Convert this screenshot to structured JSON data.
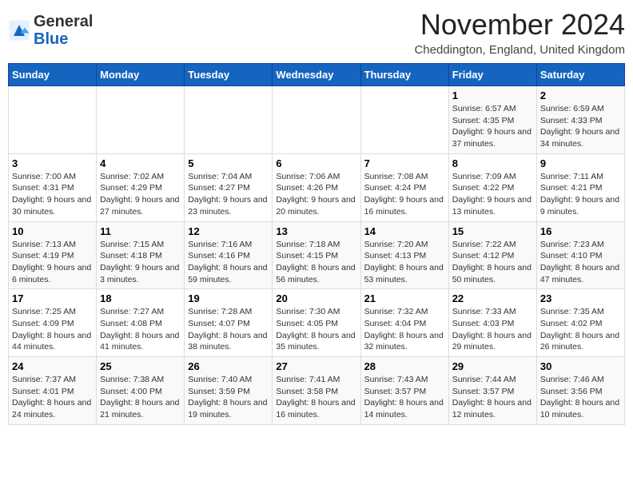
{
  "header": {
    "logo_general": "General",
    "logo_blue": "Blue",
    "month_title": "November 2024",
    "location": "Cheddington, England, United Kingdom"
  },
  "weekdays": [
    "Sunday",
    "Monday",
    "Tuesday",
    "Wednesday",
    "Thursday",
    "Friday",
    "Saturday"
  ],
  "weeks": [
    [
      {
        "day": "",
        "info": ""
      },
      {
        "day": "",
        "info": ""
      },
      {
        "day": "",
        "info": ""
      },
      {
        "day": "",
        "info": ""
      },
      {
        "day": "",
        "info": ""
      },
      {
        "day": "1",
        "info": "Sunrise: 6:57 AM\nSunset: 4:35 PM\nDaylight: 9 hours and 37 minutes."
      },
      {
        "day": "2",
        "info": "Sunrise: 6:59 AM\nSunset: 4:33 PM\nDaylight: 9 hours and 34 minutes."
      }
    ],
    [
      {
        "day": "3",
        "info": "Sunrise: 7:00 AM\nSunset: 4:31 PM\nDaylight: 9 hours and 30 minutes."
      },
      {
        "day": "4",
        "info": "Sunrise: 7:02 AM\nSunset: 4:29 PM\nDaylight: 9 hours and 27 minutes."
      },
      {
        "day": "5",
        "info": "Sunrise: 7:04 AM\nSunset: 4:27 PM\nDaylight: 9 hours and 23 minutes."
      },
      {
        "day": "6",
        "info": "Sunrise: 7:06 AM\nSunset: 4:26 PM\nDaylight: 9 hours and 20 minutes."
      },
      {
        "day": "7",
        "info": "Sunrise: 7:08 AM\nSunset: 4:24 PM\nDaylight: 9 hours and 16 minutes."
      },
      {
        "day": "8",
        "info": "Sunrise: 7:09 AM\nSunset: 4:22 PM\nDaylight: 9 hours and 13 minutes."
      },
      {
        "day": "9",
        "info": "Sunrise: 7:11 AM\nSunset: 4:21 PM\nDaylight: 9 hours and 9 minutes."
      }
    ],
    [
      {
        "day": "10",
        "info": "Sunrise: 7:13 AM\nSunset: 4:19 PM\nDaylight: 9 hours and 6 minutes."
      },
      {
        "day": "11",
        "info": "Sunrise: 7:15 AM\nSunset: 4:18 PM\nDaylight: 9 hours and 3 minutes."
      },
      {
        "day": "12",
        "info": "Sunrise: 7:16 AM\nSunset: 4:16 PM\nDaylight: 8 hours and 59 minutes."
      },
      {
        "day": "13",
        "info": "Sunrise: 7:18 AM\nSunset: 4:15 PM\nDaylight: 8 hours and 56 minutes."
      },
      {
        "day": "14",
        "info": "Sunrise: 7:20 AM\nSunset: 4:13 PM\nDaylight: 8 hours and 53 minutes."
      },
      {
        "day": "15",
        "info": "Sunrise: 7:22 AM\nSunset: 4:12 PM\nDaylight: 8 hours and 50 minutes."
      },
      {
        "day": "16",
        "info": "Sunrise: 7:23 AM\nSunset: 4:10 PM\nDaylight: 8 hours and 47 minutes."
      }
    ],
    [
      {
        "day": "17",
        "info": "Sunrise: 7:25 AM\nSunset: 4:09 PM\nDaylight: 8 hours and 44 minutes."
      },
      {
        "day": "18",
        "info": "Sunrise: 7:27 AM\nSunset: 4:08 PM\nDaylight: 8 hours and 41 minutes."
      },
      {
        "day": "19",
        "info": "Sunrise: 7:28 AM\nSunset: 4:07 PM\nDaylight: 8 hours and 38 minutes."
      },
      {
        "day": "20",
        "info": "Sunrise: 7:30 AM\nSunset: 4:05 PM\nDaylight: 8 hours and 35 minutes."
      },
      {
        "day": "21",
        "info": "Sunrise: 7:32 AM\nSunset: 4:04 PM\nDaylight: 8 hours and 32 minutes."
      },
      {
        "day": "22",
        "info": "Sunrise: 7:33 AM\nSunset: 4:03 PM\nDaylight: 8 hours and 29 minutes."
      },
      {
        "day": "23",
        "info": "Sunrise: 7:35 AM\nSunset: 4:02 PM\nDaylight: 8 hours and 26 minutes."
      }
    ],
    [
      {
        "day": "24",
        "info": "Sunrise: 7:37 AM\nSunset: 4:01 PM\nDaylight: 8 hours and 24 minutes."
      },
      {
        "day": "25",
        "info": "Sunrise: 7:38 AM\nSunset: 4:00 PM\nDaylight: 8 hours and 21 minutes."
      },
      {
        "day": "26",
        "info": "Sunrise: 7:40 AM\nSunset: 3:59 PM\nDaylight: 8 hours and 19 minutes."
      },
      {
        "day": "27",
        "info": "Sunrise: 7:41 AM\nSunset: 3:58 PM\nDaylight: 8 hours and 16 minutes."
      },
      {
        "day": "28",
        "info": "Sunrise: 7:43 AM\nSunset: 3:57 PM\nDaylight: 8 hours and 14 minutes."
      },
      {
        "day": "29",
        "info": "Sunrise: 7:44 AM\nSunset: 3:57 PM\nDaylight: 8 hours and 12 minutes."
      },
      {
        "day": "30",
        "info": "Sunrise: 7:46 AM\nSunset: 3:56 PM\nDaylight: 8 hours and 10 minutes."
      }
    ]
  ]
}
